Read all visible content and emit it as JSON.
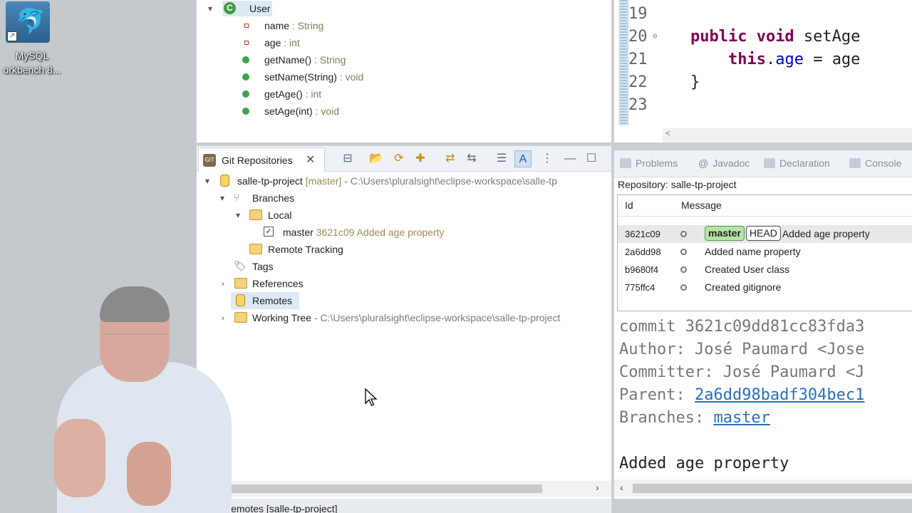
{
  "desktop": {
    "icon_label_1": "MySQL",
    "icon_label_2": "orkbench 8..."
  },
  "outline": {
    "class_name": "User",
    "members": [
      {
        "name": "name",
        "type": " : String",
        "kind": "field"
      },
      {
        "name": "age",
        "type": " : int",
        "kind": "field"
      },
      {
        "name": "getName()",
        "type": " : String",
        "kind": "method"
      },
      {
        "name": "setName(String)",
        "type": " : void",
        "kind": "method"
      },
      {
        "name": "getAge()",
        "type": " : int",
        "kind": "method"
      },
      {
        "name": "setAge(int)",
        "type": " : void",
        "kind": "method"
      }
    ]
  },
  "editor": {
    "lines": [
      {
        "num": "19",
        "code": ""
      },
      {
        "num": "20",
        "code": "    public void setAge"
      },
      {
        "num": "21",
        "code": "        this.age = age"
      },
      {
        "num": "22",
        "code": "    }"
      },
      {
        "num": "23",
        "code": ""
      }
    ]
  },
  "git_view": {
    "tab_label": "Git Repositories",
    "repo_name": "salle-tp-project",
    "repo_branch": " [master]",
    "repo_path": " - C:\\Users\\pluralsight\\eclipse-workspace\\salle-tp",
    "branches": "Branches",
    "local": "Local",
    "master_name": "master",
    "master_detail": " 3621c09 Added age property",
    "remote_tracking": "Remote Tracking",
    "tags": "Tags",
    "references": "References",
    "remotes": "Remotes",
    "working_tree": "Working Tree",
    "working_tree_path": " - C:\\Users\\pluralsight\\eclipse-workspace\\salle-tp-project"
  },
  "status_bar": "Remotes [salle-tp-project]",
  "right_panel": {
    "tabs": [
      "Problems",
      "Javadoc",
      "Declaration",
      "Console"
    ],
    "repository_label": "Repository: salle-tp-project",
    "columns": {
      "id": "Id",
      "message": "Message"
    },
    "commits": [
      {
        "id": "3621c09",
        "message": "Added age property",
        "branch": "master",
        "head": "HEAD"
      },
      {
        "id": "2a6dd98",
        "message": "Added name property"
      },
      {
        "id": "b9680f4",
        "message": "Created User class"
      },
      {
        "id": "775ffc4",
        "message": "Created gitignore"
      }
    ],
    "details": {
      "commit": "commit 3621c09dd81cc83fda3",
      "author": "Author: José Paumard <Jose",
      "committer": "Committer: José Paumard <J",
      "parent_label": "Parent: ",
      "parent_link": "2a6dd98badf304bec1",
      "branches_label": "Branches: ",
      "branches_link": "master",
      "message": "Added age property"
    }
  },
  "colors": {
    "keyword": "#7f0055",
    "field": "#0000c0",
    "link": "#2a6fbf",
    "branch_badge": "#b6e3a6"
  }
}
